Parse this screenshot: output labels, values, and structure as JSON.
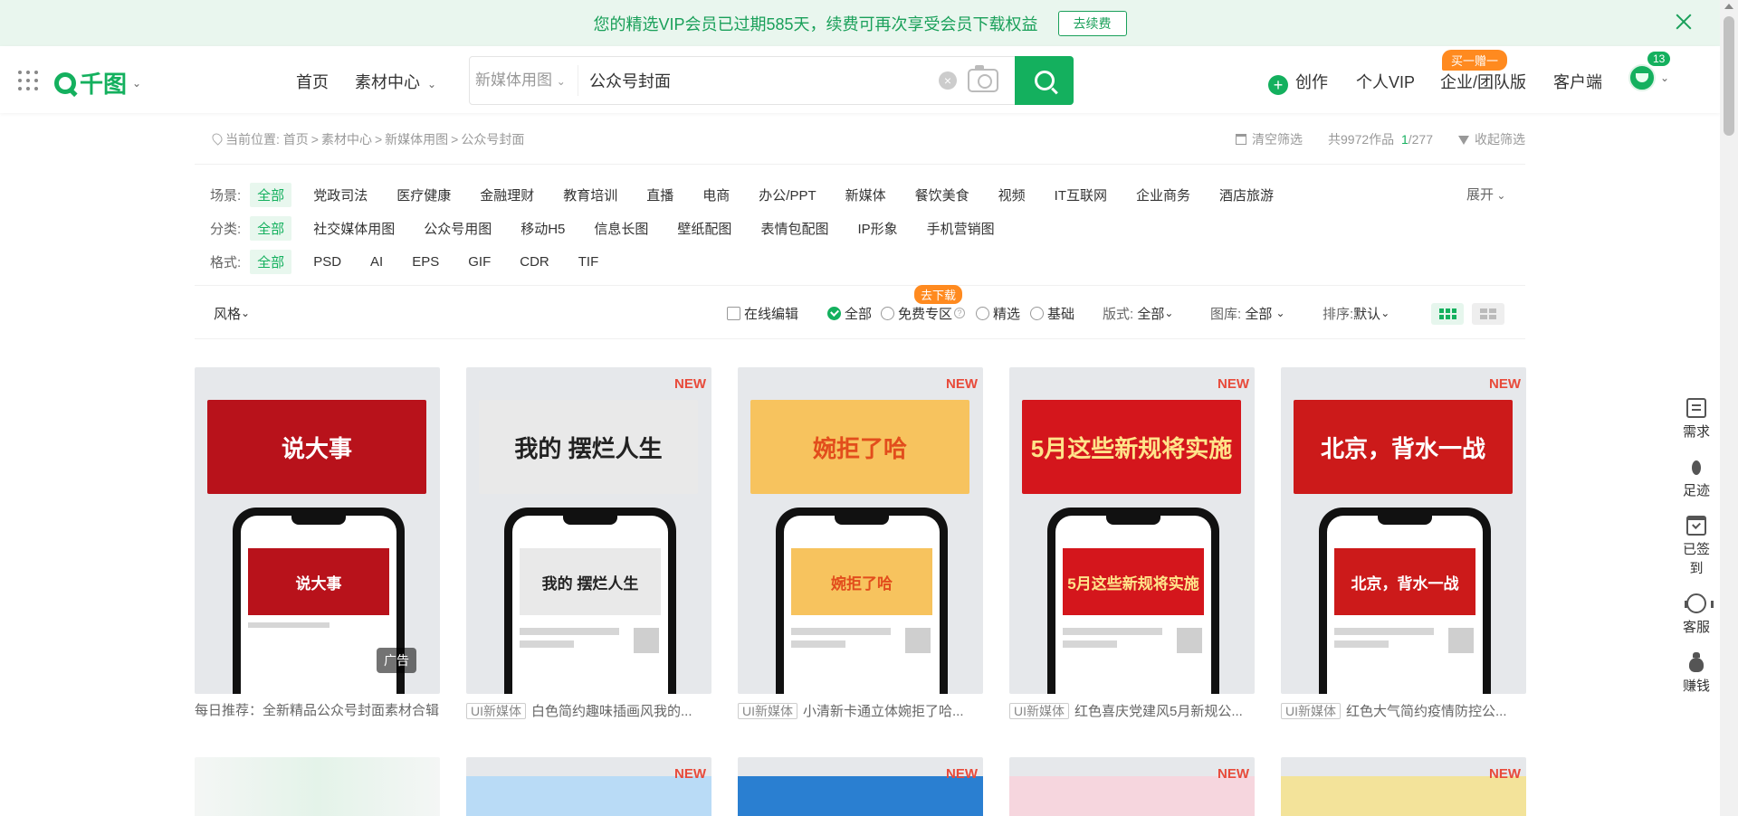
{
  "vip_banner": {
    "text": "您的精选VIP会员已过期585天，续费可再次享受会员下载权益",
    "button": "去续费"
  },
  "header": {
    "logo": "千图",
    "nav": [
      {
        "label": "首页"
      },
      {
        "label": "素材中心"
      }
    ],
    "search": {
      "category": "新媒体用图",
      "value": "公众号封面"
    },
    "create": "创作",
    "personal_vip": "个人VIP",
    "enterprise": "企业/团队版",
    "enterprise_badge": "买一赠一",
    "client": "客户端",
    "msg_count": "13"
  },
  "crumb": {
    "label": "当前位置:",
    "items": [
      "首页",
      "素材中心",
      "新媒体用图",
      "公众号封面"
    ],
    "clear": "清空筛选",
    "total": "共9972作品",
    "page_current": "1",
    "page_total": "/277",
    "collapse": "收起筛选"
  },
  "filters": {
    "scene": {
      "label": "场景:",
      "options": [
        "全部",
        "党政司法",
        "医疗健康",
        "金融理财",
        "教育培训",
        "直播",
        "电商",
        "办公/PPT",
        "新媒体",
        "餐饮美食",
        "视频",
        "IT互联网",
        "企业商务",
        "酒店旅游"
      ]
    },
    "category": {
      "label": "分类:",
      "options": [
        "全部",
        "社交媒体用图",
        "公众号用图",
        "移动H5",
        "信息长图",
        "壁纸配图",
        "表情包配图",
        "IP形象",
        "手机营销图"
      ]
    },
    "format": {
      "label": "格式:",
      "options": [
        "全部",
        "PSD",
        "AI",
        "EPS",
        "GIF",
        "CDR",
        "TIF"
      ]
    },
    "expand": "展开"
  },
  "options": {
    "style": "风格",
    "online_edit": "在线编辑",
    "all": "全部",
    "free_zone": "免费专区",
    "featured": "精选",
    "basic": "基础",
    "download_tag": "去下载",
    "layout_label": "版式:",
    "layout_value": "全部",
    "gallery_label": "图库:",
    "gallery_value": "全部",
    "sort_label": "排序:",
    "sort_value": "默认"
  },
  "cards": [
    {
      "banner": "说大事",
      "caption_tag": "",
      "caption": "每日推荐：全新精品公众号封面素材合辑",
      "new": "",
      "ad": "广告",
      "bg": "#b8121b",
      "fg": "#ffffff"
    },
    {
      "banner": "我的 摆烂人生",
      "caption_tag": "UI新媒体",
      "caption": "白色简约趣味插画风我的...",
      "new": "NEW",
      "ad": "",
      "bg": "#e9e9e9",
      "fg": "#222222"
    },
    {
      "banner": "婉拒了哈",
      "caption_tag": "UI新媒体",
      "caption": "小清新卡通立体婉拒了哈...",
      "new": "NEW",
      "ad": "",
      "bg": "#f7c35e",
      "fg": "#e24d1c"
    },
    {
      "banner": "5月这些新规将实施",
      "caption_tag": "UI新媒体",
      "caption": "红色喜庆党建风5月新规公...",
      "new": "NEW",
      "ad": "",
      "bg": "#d4161c",
      "fg": "#ffe48a"
    },
    {
      "banner": "北京，背水一战",
      "caption_tag": "UI新媒体",
      "caption": "红色大气简约疫情防控公...",
      "new": "NEW",
      "ad": "",
      "bg": "#cc1a1a",
      "fg": "#ffffff"
    }
  ],
  "row2_new": "NEW",
  "sidebar": [
    "需求",
    "足迹",
    "已签到",
    "客服",
    "赚钱"
  ],
  "colors": {
    "brand": "#14b05e",
    "new_tag": "#e84a3a",
    "badge": "#ff8a1f"
  }
}
